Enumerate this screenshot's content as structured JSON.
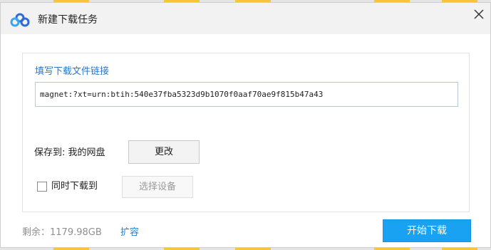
{
  "dialog": {
    "title": "新建下载任务",
    "close_icon": "close-icon",
    "logo_icon": "cloud-logo-icon"
  },
  "link": {
    "label": "填写下载文件链接",
    "value": "magnet:?xt=urn:btih:540e37fba5323d9b1070f0aaf70ae9f815b47a43"
  },
  "save": {
    "label": "保存到: 我的网盘",
    "change_button": "更改"
  },
  "sync": {
    "checkbox_label": "同时下载到",
    "checked": false,
    "device_button": "选择设备"
  },
  "footer": {
    "remaining": "剩余：1179.98GB",
    "expand_link": "扩容",
    "start_button": "开始下载"
  },
  "colors": {
    "accent_blue": "#1aa2f2",
    "link_blue": "#1c7fd6",
    "label_blue": "#2a78c8",
    "strip_yellow": "#f5c53b"
  }
}
